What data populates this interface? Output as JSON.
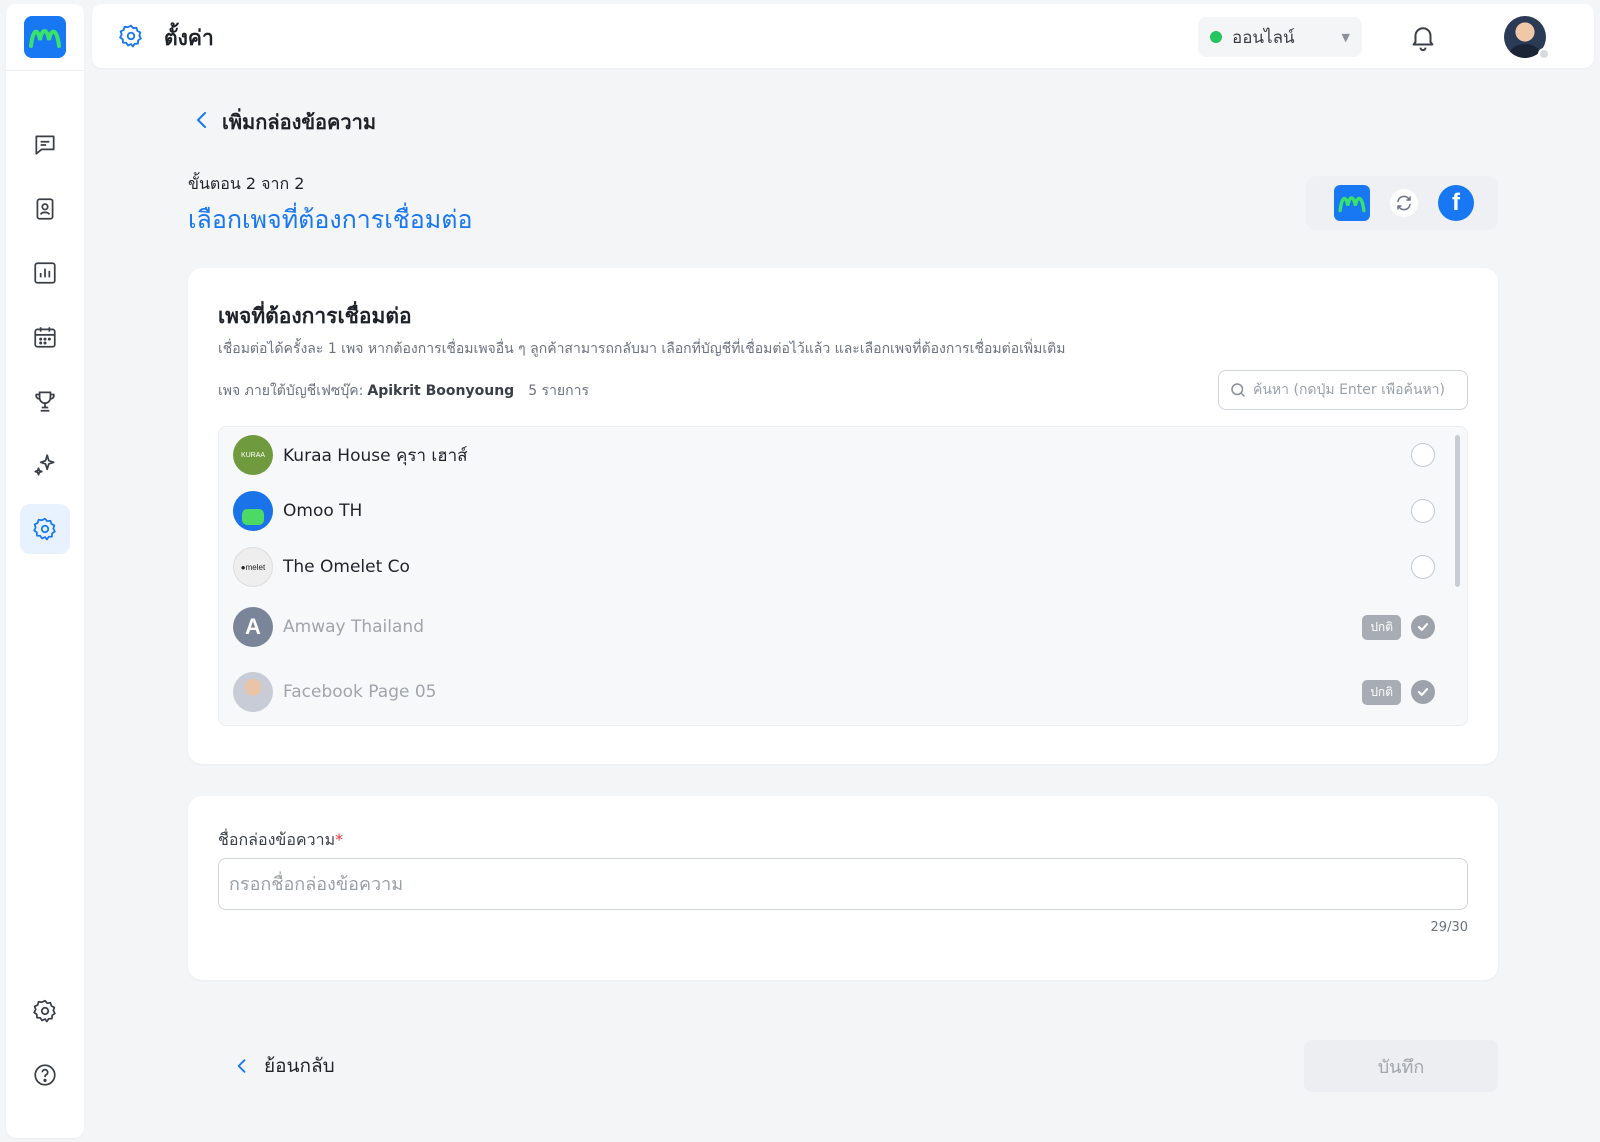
{
  "header": {
    "title": "ตั้งค่า",
    "status": {
      "label": "ออนไลน์",
      "color": "#22c55e"
    }
  },
  "sidebar": {
    "items": [
      {
        "name": "chat",
        "icon": "chat-icon"
      },
      {
        "name": "contacts",
        "icon": "contact-card-icon"
      },
      {
        "name": "reports",
        "icon": "bar-chart-icon"
      },
      {
        "name": "calendar",
        "icon": "calendar-icon"
      },
      {
        "name": "rewards",
        "icon": "trophy-icon"
      },
      {
        "name": "ai",
        "icon": "sparkle-icon"
      },
      {
        "name": "settings",
        "icon": "gear-icon",
        "active": true
      }
    ],
    "bottom": [
      {
        "name": "preferences",
        "icon": "gear-icon"
      },
      {
        "name": "help",
        "icon": "help-icon"
      }
    ]
  },
  "page": {
    "title": "เพิ่มกล่องข้อความ",
    "step_label": "ขั้นตอน 2 จาก 2",
    "step_title": "เลือกเพจที่ต้องการเชื่อมต่อ"
  },
  "pages_card": {
    "title": "เพจที่ต้องการเชื่อมต่อ",
    "description": "เชื่อมต่อได้ครั้งละ 1 เพจ หากต้องการเชื่อมเพจอื่น ๆ ลูกค้าสามารถกลับมา เลือกที่บัญชีที่เชื่อมต่อไว้แล้ว และเลือกเพจที่ต้องการเชื่อมต่อเพิ่มเติม",
    "account_prefix": "เพจ ภายใต้บัญชีเฟซบุ๊ค:",
    "account_name": "Apikrit Boonyoung",
    "count_label": "5 รายการ",
    "search_placeholder": "ค้นหา (กดปุ่ม Enter เพื่อค้นหา)",
    "badge_label": "ปกติ",
    "pages": [
      {
        "name": "Kuraa House คุรา เฮาส์",
        "connected": false,
        "thumb_color": "#6f9a3e"
      },
      {
        "name": "Omoo TH",
        "connected": false,
        "thumb_color": "#1a73e8"
      },
      {
        "name": "The Omelet Co",
        "connected": false,
        "thumb_color": "#eeeeee"
      },
      {
        "name": "Amway Thailand",
        "connected": true,
        "thumb_color": "#7a8599",
        "thumb_letter": "A"
      },
      {
        "name": "Facebook Page 05",
        "connected": true,
        "thumb_color": "#c7ccd6"
      }
    ]
  },
  "inbox_form": {
    "label": "ชื่อกล่องข้อความ",
    "required_mark": "*",
    "placeholder": "กรอกชื่อกล่องข้อความ",
    "counter": "29/30"
  },
  "footer": {
    "back_label": "ย้อนกลับ",
    "save_label": "บันทึก"
  },
  "colors": {
    "accent": "#1877f2",
    "online": "#22c55e"
  }
}
